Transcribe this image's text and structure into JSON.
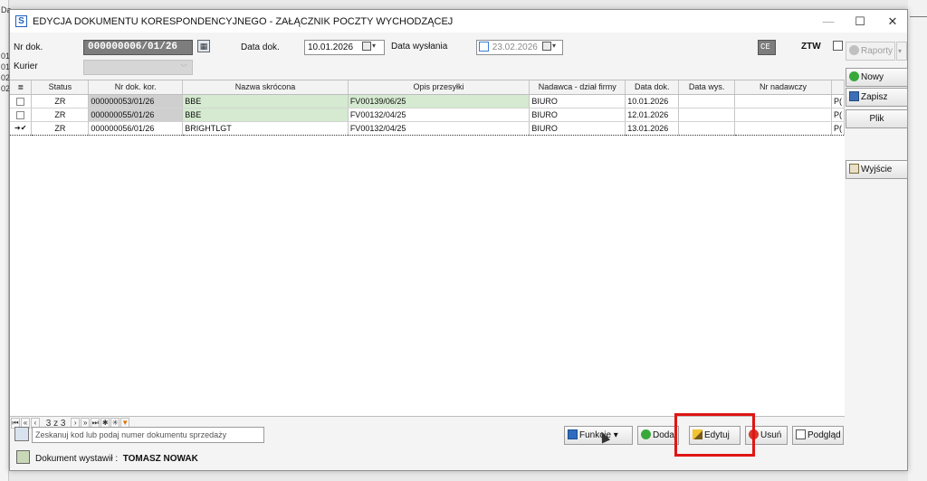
{
  "background": {
    "left_labels": [
      "Da",
      "01",
      "01",
      "02",
      "02"
    ]
  },
  "window": {
    "title": "EDYCJA DOKUMENTU KORESPONDENCYJNEGO - ZAŁĄCZNIK POCZTY WYCHODZĄCEJ",
    "app_icon": "S",
    "minimize": "—",
    "maximize": "☐",
    "close": "✕"
  },
  "form": {
    "nr_dok_label": "Nr dok.",
    "nr_dok_value": "000000006/01/26",
    "data_dok_label": "Data dok.",
    "data_dok_value": "10.01.2026",
    "data_wyslania_label": "Data wysłania",
    "data_wyslania_value": "23.02.2026",
    "kurier_label": "Kurier",
    "kurier_value": "",
    "ce_value": "CE",
    "ztw_label": "ZTW"
  },
  "grid": {
    "columns": [
      "",
      "Status",
      "Nr dok. kor.",
      "Nazwa skrócona",
      "Opis przesyłki",
      "Nadawca - dział firmy",
      "Data dok.",
      "Data wys.",
      "Nr nadawczy",
      ""
    ],
    "rows": [
      {
        "marker": "",
        "status": "ZR",
        "nr": "000000053/01/26",
        "nazwa": "BBE",
        "opis": "FV00139/06/25",
        "nadawca": "BIURO",
        "data_dok": "10.01.2026",
        "data_wys": "",
        "nr_nadawczy": "",
        "extra": "P("
      },
      {
        "marker": "",
        "status": "ZR",
        "nr": "000000055/01/26",
        "nazwa": "BBE",
        "opis": "FV00132/04/25",
        "nadawca": "BIURO",
        "data_dok": "12.01.2026",
        "data_wys": "",
        "nr_nadawczy": "",
        "extra": "P("
      },
      {
        "marker": "➔✔",
        "status": "ZR",
        "nr": "000000056/01/26",
        "nazwa": "BRIGHTLGT",
        "opis": "FV00132/04/25",
        "nadawca": "BIURO",
        "data_dok": "13.01.2026",
        "data_wys": "",
        "nr_nadawczy": "",
        "extra": "P("
      }
    ]
  },
  "navigator": {
    "page_text": "3 z 3"
  },
  "scan": {
    "placeholder": "Zeskanuj kod lub podaj numer dokumentu sprzedaży"
  },
  "actions": {
    "funkcje": "Funkcje",
    "dodaj": "Dodaj",
    "edytuj": "Edytuj",
    "usun": "Usuń",
    "podglad": "Podgląd"
  },
  "side": {
    "raporty": "Raporty",
    "nowy": "Nowy",
    "zapisz": "Zapisz",
    "plik": "Plik",
    "wyjscie": "Wyjście"
  },
  "footer": {
    "label": "Dokument wystawił :",
    "user": "TOMASZ NOWAK"
  },
  "colors": {
    "highlight": "#e01515",
    "green_cell": "#d5ead0",
    "gray_cell": "#cfcfcf"
  }
}
